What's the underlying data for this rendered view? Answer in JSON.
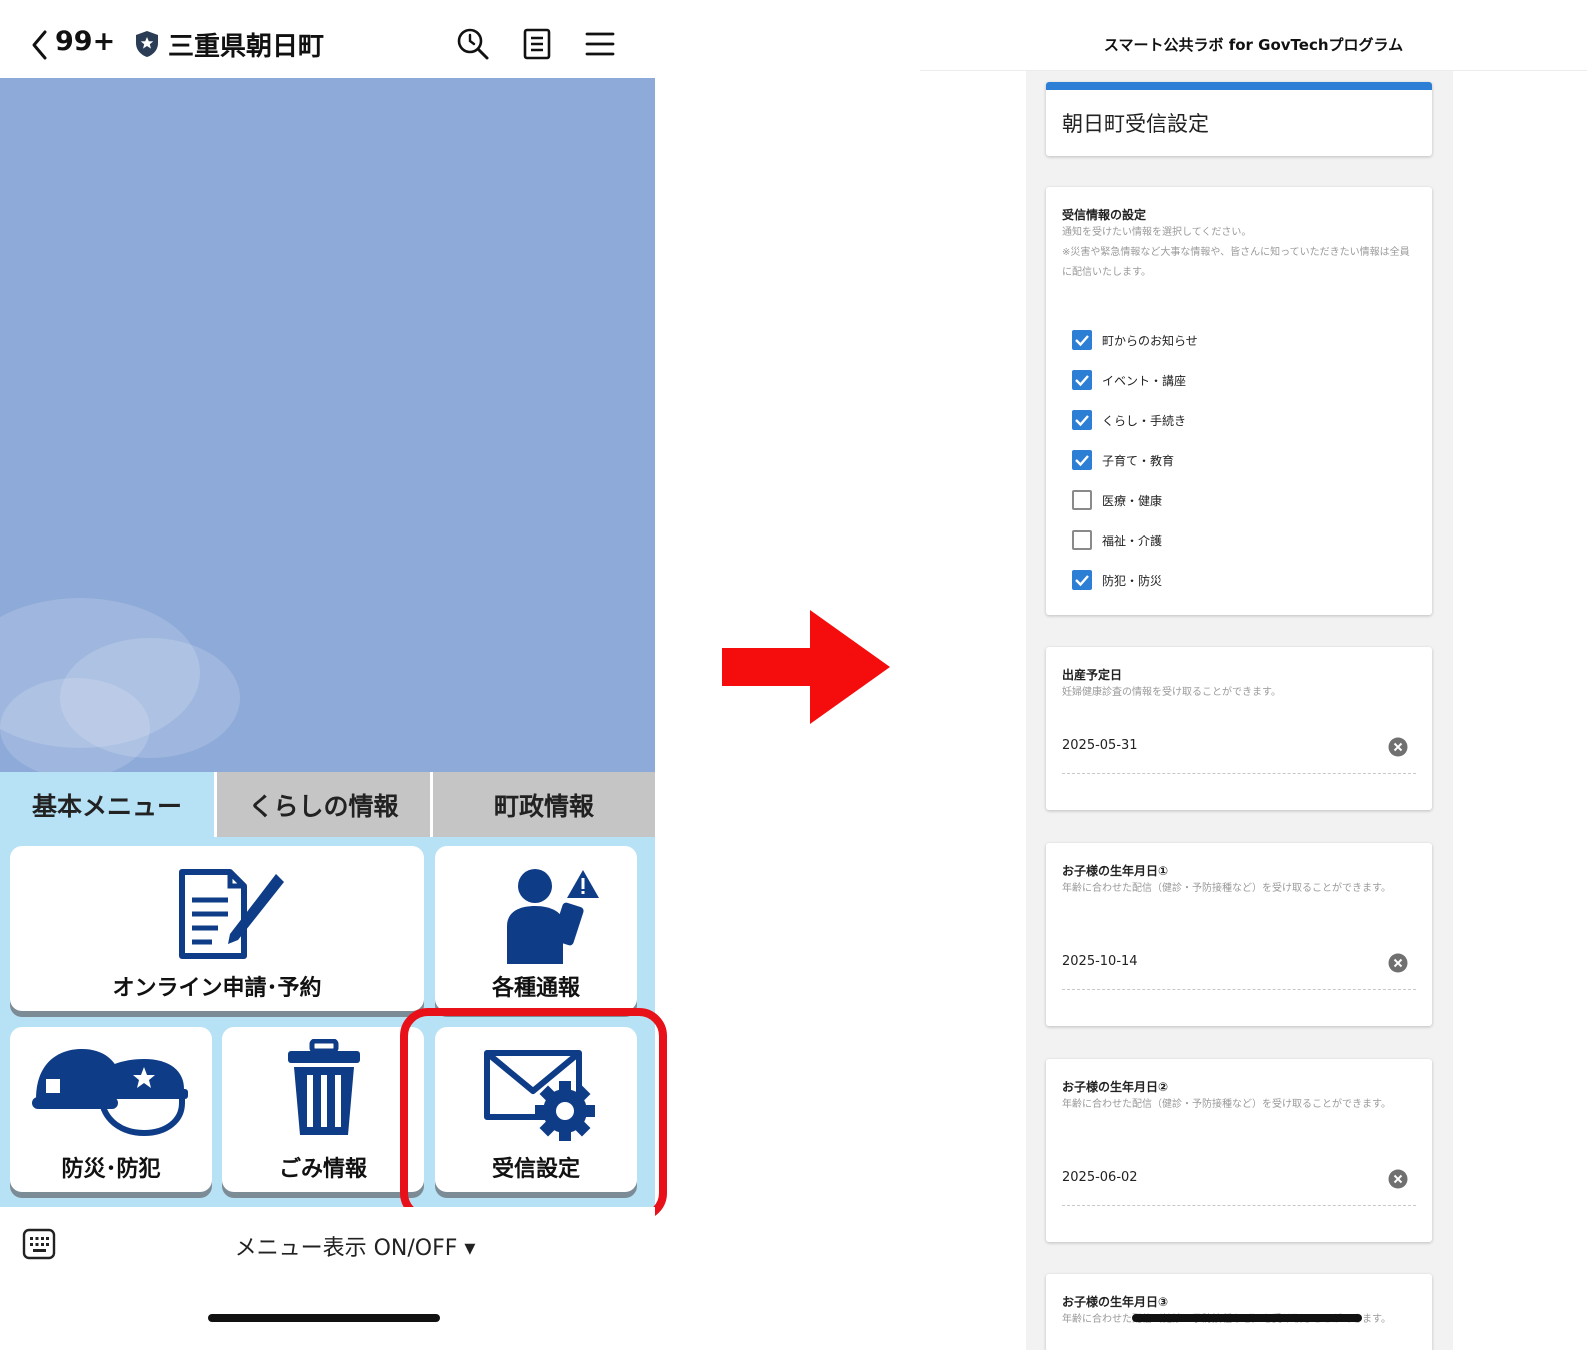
{
  "left": {
    "header": {
      "back_count": "99+",
      "account_name": "三重県朝日町"
    },
    "tabs": [
      {
        "label": "基本メニュー",
        "active": true
      },
      {
        "label": "くらしの情報",
        "active": false
      },
      {
        "label": "町政情報",
        "active": false
      }
    ],
    "menu": {
      "online": "オンライン申請･予約",
      "report": "各種通報",
      "disaster": "防災･防犯",
      "garbage": "ごみ情報",
      "settings": "受信設定"
    },
    "toggle_label": "メニュー表示 ON/OFF ▾"
  },
  "right": {
    "header_title": "スマート公共ラボ for GovTechプログラム",
    "page_title": "朝日町受信設定",
    "receive": {
      "title": "受信情報の設定",
      "desc1": "通知を受けたい情報を選択してください。",
      "desc2": "※災害や緊急情報など大事な情報や、皆さんに知っていただきたい情報は全員に配信いたします。",
      "options": [
        {
          "label": "町からのお知らせ",
          "checked": true
        },
        {
          "label": "イベント・講座",
          "checked": true
        },
        {
          "label": "くらし・手続き",
          "checked": true
        },
        {
          "label": "子育て・教育",
          "checked": true
        },
        {
          "label": "医療・健康",
          "checked": false
        },
        {
          "label": "福祉・介護",
          "checked": false
        },
        {
          "label": "防犯・防災",
          "checked": true
        }
      ]
    },
    "due": {
      "title": "出産予定日",
      "desc": "妊婦健康診査の情報を受け取ることができます。",
      "value": "2025-05-31"
    },
    "child1": {
      "title": "お子様の生年月日①",
      "desc": "年齢に合わせた配信（健診・予防接種など）を受け取ることができます。",
      "value": "2025-10-14"
    },
    "child2": {
      "title": "お子様の生年月日②",
      "desc": "年齢に合わせた配信（健診・予防接種など）を受け取ることができます。",
      "value": "2025-06-02"
    },
    "child3": {
      "title": "お子様の生年月日③",
      "desc": "年齢に合わせた配信（健診・予防接種など）を受け取ることができます。"
    }
  },
  "colors": {
    "banner": "#8daad8",
    "menu_bg": "#b7e1f5",
    "icon_blue": "#0f3c87",
    "highlight": "#e8111a",
    "checkbox": "#2d7fd6"
  },
  "icons": [
    "chevron-left-icon",
    "shield-star-icon",
    "search-clock-icon",
    "notebook-icon",
    "hamburger-icon",
    "application-form-icon",
    "person-alert-icon",
    "helmets-icon",
    "trash-icon",
    "mail-gear-icon",
    "keyboard-icon",
    "clear-icon"
  ]
}
